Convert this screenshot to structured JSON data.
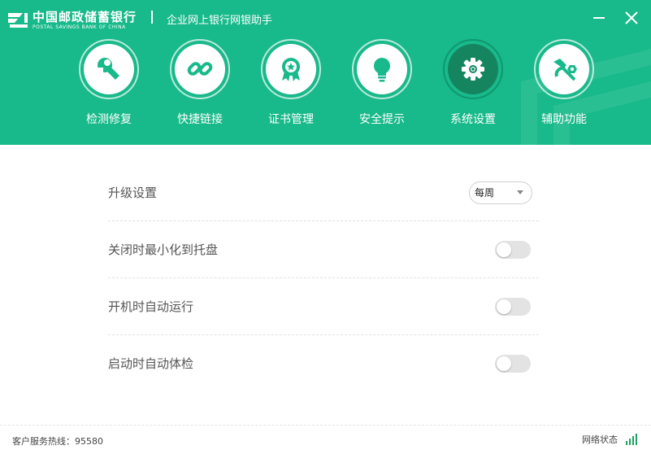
{
  "header": {
    "bank_name_cn": "中国邮政储蓄银行",
    "bank_name_en": "POSTAL SAVINGS BANK OF CHINA",
    "app_title": "企业网上银行网银助手"
  },
  "nav": {
    "items": [
      {
        "label": "检测修复",
        "icon": "wrench-icon"
      },
      {
        "label": "快捷链接",
        "icon": "link-icon"
      },
      {
        "label": "证书管理",
        "icon": "certificate-icon"
      },
      {
        "label": "安全提示",
        "icon": "lightbulb-icon"
      },
      {
        "label": "系统设置",
        "icon": "gear-icon",
        "active": true
      },
      {
        "label": "辅助功能",
        "icon": "tools-icon"
      }
    ]
  },
  "settings": {
    "upgrade": {
      "label": "升级设置",
      "selected": "每周"
    },
    "minimize_tray": {
      "label": "关闭时最小化到托盘",
      "enabled": false
    },
    "autostart": {
      "label": "开机时自动运行",
      "enabled": false
    },
    "autocheck": {
      "label": "启动时自动体检",
      "enabled": false
    }
  },
  "footer": {
    "hotline": "客户服务热线：95580",
    "network_status": "网络状态"
  },
  "colors": {
    "brand": "#18b98a",
    "active_nav": "#14855f",
    "signal": "#1ba35e"
  }
}
